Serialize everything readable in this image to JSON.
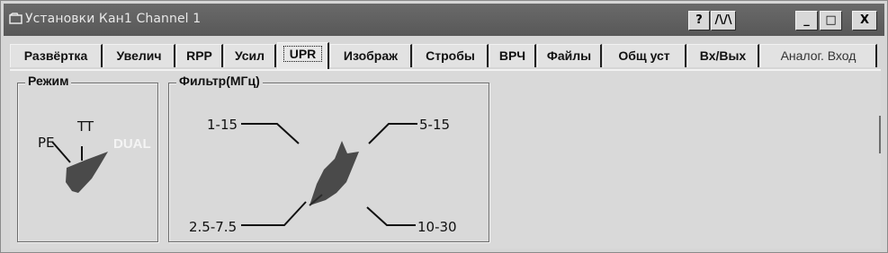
{
  "window": {
    "title": "Установки Кан1 Channel 1",
    "help_button": "?",
    "plot_button": "/\\/\\",
    "minimize_label": "_",
    "maximize_label": "□",
    "close_label": "X"
  },
  "tabs": [
    {
      "label": "Развёртка"
    },
    {
      "label": "Увелич"
    },
    {
      "label": "RPP"
    },
    {
      "label": "Усил"
    },
    {
      "label": "UPR",
      "active": true
    },
    {
      "label": "Изображ"
    },
    {
      "label": "Стробы"
    },
    {
      "label": "ВРЧ"
    },
    {
      "label": "Файлы"
    },
    {
      "label": "Общ уст"
    },
    {
      "label": "Вх/Вых"
    },
    {
      "label": "Аналог. Вход",
      "disabled": true
    }
  ],
  "mode_group": {
    "title": "Режим",
    "options": [
      "PE",
      "TT",
      "DUAL"
    ],
    "selected": "DUAL"
  },
  "filter_group": {
    "title": "Фильтр(МГц)",
    "options": [
      "1-15",
      "5-15",
      "2.5-7.5",
      "10-30"
    ],
    "selected": "2.5-7.5"
  },
  "colors": {
    "titlebar": "#5e5e5e",
    "knob": "#4a4a4a",
    "background": "#d9d9d9"
  }
}
